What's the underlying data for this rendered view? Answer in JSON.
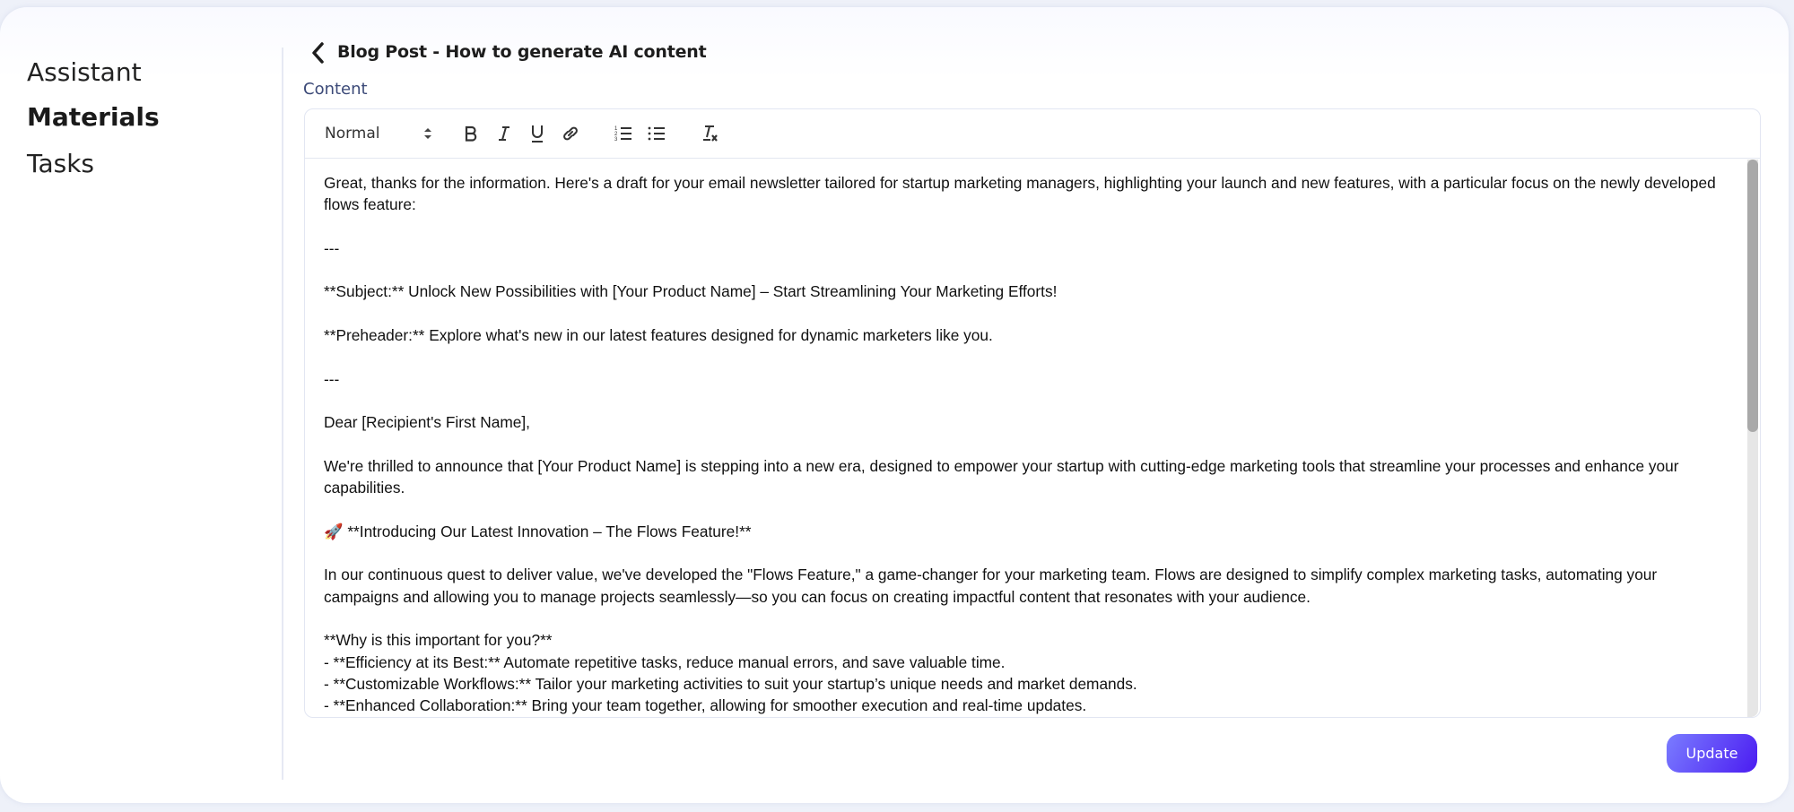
{
  "sidebar": {
    "items": [
      {
        "label": "Assistant",
        "active": false
      },
      {
        "label": "Materials",
        "active": true
      },
      {
        "label": "Tasks",
        "active": false
      }
    ]
  },
  "header": {
    "back_icon": "chevron-left-icon",
    "title": "Blog Post - How to generate AI content"
  },
  "editor": {
    "label": "Content",
    "toolbar": {
      "format_select": "Normal",
      "buttons": [
        "bold",
        "italic",
        "underline",
        "link",
        "ordered-list",
        "bullet-list",
        "clear-formatting"
      ]
    },
    "paragraphs": [
      "Great, thanks for the information. Here's a draft for your email newsletter tailored for startup marketing managers, highlighting your launch and new features, with a particular focus on the newly developed flows feature:",
      "",
      "---",
      "",
      "**Subject:** Unlock New Possibilities with [Your Product Name] – Start Streamlining Your Marketing Efforts!",
      "",
      "**Preheader:** Explore what's new in our latest features designed for dynamic marketers like you.",
      "",
      "---",
      "",
      "Dear [Recipient's First Name],",
      "",
      "We're thrilled to announce that [Your Product Name] is stepping into a new era, designed to empower your startup with cutting-edge marketing tools that streamline your processes and enhance your capabilities.",
      "",
      "🚀 **Introducing Our Latest Innovation – The Flows Feature!**",
      "",
      "In our continuous quest to deliver value, we've developed the \"Flows Feature,\" a game-changer for your marketing team. Flows are designed to simplify complex marketing tasks, automating your campaigns and allowing you to manage projects seamlessly—so you can focus on creating impactful content that resonates with your audience.",
      "",
      "**Why is this important for you?**",
      "- **Efficiency at its Best:** Automate repetitive tasks, reduce manual errors, and save valuable time.",
      "- **Customizable Workflows:** Tailor your marketing activities to suit your startup’s unique needs and market demands.",
      "- **Enhanced Collaboration:** Bring your team together, allowing for smoother execution and real-time updates."
    ]
  },
  "actions": {
    "update_label": "Update"
  },
  "colors": {
    "accent_start": "#7a7cff",
    "accent_end": "#4b1cf1",
    "label": "#3c4a78"
  }
}
